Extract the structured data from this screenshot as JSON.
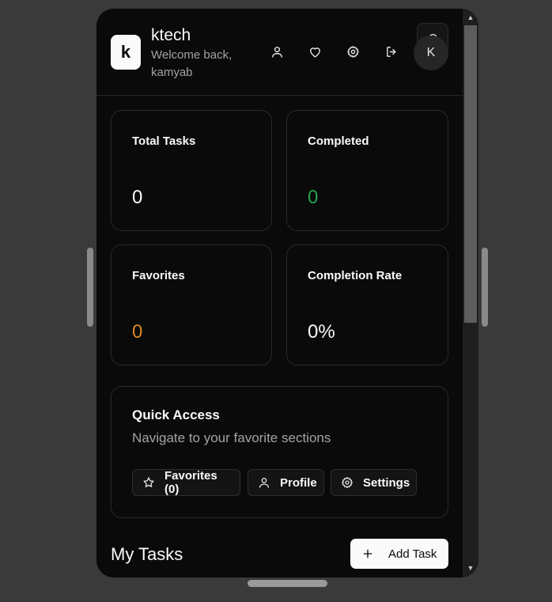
{
  "header": {
    "logo_letter": "k",
    "title": "ktech",
    "welcome": "Welcome back, kamyab",
    "avatar_initial": "K",
    "icons": [
      "user-icon",
      "heart-icon",
      "gear-icon",
      "logout-icon",
      "bell-icon"
    ]
  },
  "stats": [
    {
      "label": "Total Tasks",
      "value": "0",
      "color": "#fafafa"
    },
    {
      "label": "Completed",
      "value": "0",
      "color": "#22a550"
    },
    {
      "label": "Favorites",
      "value": "0",
      "color": "#d98a1e"
    },
    {
      "label": "Completion Rate",
      "value": "0%",
      "color": "#fafafa"
    }
  ],
  "quick_access": {
    "title": "Quick Access",
    "subtitle": "Navigate to your favorite sections",
    "buttons": [
      {
        "label": "Favorites (0)",
        "icon": "star-icon"
      },
      {
        "label": "Profile",
        "icon": "user-icon"
      },
      {
        "label": "Settings",
        "icon": "gear-icon"
      }
    ]
  },
  "tasks": {
    "title": "My Tasks",
    "add_label": "Add Task",
    "add_icon": "plus-icon"
  },
  "scrollbar": {
    "up_arrow": "▲",
    "down_arrow": "▼"
  },
  "colors": {
    "background": "#0a0a0a",
    "border": "#2a2a2a",
    "muted_text": "#a3a3a3",
    "completed_green": "#22a550",
    "favorites_orange": "#d98a1e"
  }
}
